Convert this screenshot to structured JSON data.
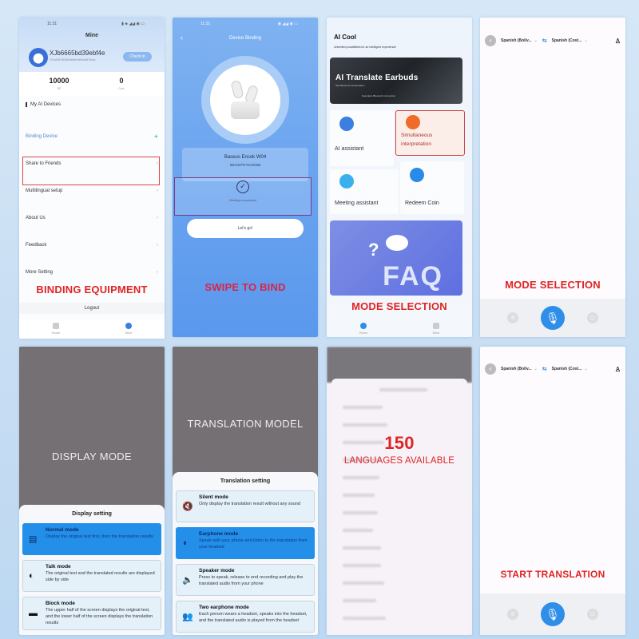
{
  "panels": {
    "binding_equipment": {
      "status_time": "11:31",
      "title": "Mine",
      "username": "XJb6665bd39ebf4e",
      "user_id": "f72ccf3810f2f8c9a9eb3e6ea5876d4c",
      "checkin_label": "Check in",
      "stats": [
        {
          "value": "10000",
          "label": "EP"
        },
        {
          "value": "0",
          "label": "Coin"
        }
      ],
      "section_title": "My AI Devices",
      "binding_device_label": "Binding Device",
      "menu": [
        "Share to Friends",
        "Multilingual setup",
        "About Us",
        "Feedback",
        "More Setting"
      ],
      "caption": "BINDING EQUIPMENT",
      "logout_label": "Logout",
      "tabs": [
        "Home",
        "Mine"
      ]
    },
    "swipe_to_bind": {
      "status_time": "11:32",
      "title": "Device Binding",
      "device_name": "Baseus Encok W04",
      "device_mac": "50:C0:F0:74:C9:88",
      "status_text": "Binding succeeded",
      "button_label": "Let's go!",
      "caption": "SWIPE TO BIND"
    },
    "ai_cool": {
      "title": "AI Cool",
      "subtitle": "Unlimited possibilities for an intelligent experience!",
      "banner_title": "AI Translate Earbuds",
      "banner_sub": "Simultaneous interpretation",
      "banner_sub2": "Seamless Bluetooth connection",
      "tiles": [
        "AI assistant",
        "Simultaneous interpretation",
        "Meeting assistant",
        "Redeem Coin"
      ],
      "faq_label": "FAQ",
      "caption": "MODE SELECTION",
      "tabs": [
        "Home",
        "Mine"
      ]
    },
    "translator_top": {
      "source_lang": "Spanish (Boliv...",
      "target_lang": "Spanish (Cost...",
      "caption": "MODE SELECTION"
    },
    "display_mode": {
      "caption": "DISPLAY MODE",
      "sheet_title": "Display setting",
      "options": [
        {
          "title": "Normal mode",
          "desc": "Display the original text first, then the translation results",
          "selected": true
        },
        {
          "title": "Talk mode",
          "desc": "The original text and the translated results are displayed side by side",
          "selected": false
        },
        {
          "title": "Block mode",
          "desc": "The upper half of the screen displays the original text, and the lower half of the screen displays the translation results",
          "selected": false
        }
      ]
    },
    "translation_model": {
      "caption": "TRANSLATION MODEL",
      "sheet_title": "Translation setting",
      "options": [
        {
          "title": "Silent mode",
          "desc": "Only display the translation result without any sound",
          "selected": false
        },
        {
          "title": "Earphone mode",
          "desc": "Speak with your phone and listen to the translation from your headset",
          "selected": true
        },
        {
          "title": "Speaker mode",
          "desc": "Press to speak, release to end recording and play the translated audio from your phone",
          "selected": false
        },
        {
          "title": "Two earphone mode",
          "desc": "Each person wears a headset, speaks into the headset, and the translated audio is played from the headset",
          "selected": false
        }
      ]
    },
    "languages": {
      "count": "150",
      "caption": "LANGUAGES AVAILABLE"
    },
    "translator_bottom": {
      "source_lang": "Spanish (Boliv...",
      "target_lang": "Spanish (Cost...",
      "caption": "START TRANSLATION"
    }
  },
  "colors": {
    "accent": "#2f8ee8",
    "caption_red": "#e02424",
    "highlight_border": "#dd4444"
  }
}
